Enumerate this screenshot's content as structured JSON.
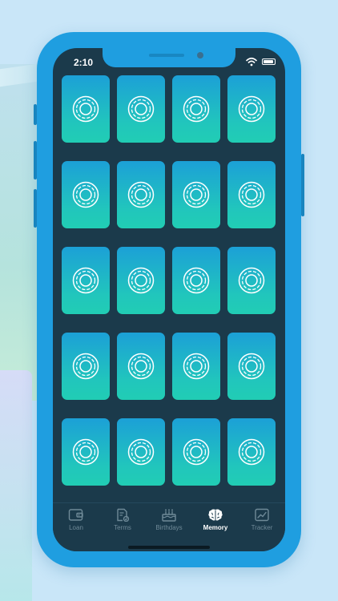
{
  "status": {
    "time": "2:10"
  },
  "icons": {
    "card": "chip-ring-icon",
    "wifi": "wifi-icon",
    "battery": "battery-icon"
  },
  "colors": {
    "phone_frame": "#1f9ee0",
    "screen_bg": "#1b3a4b",
    "card_top": "#1ca0d7",
    "card_bottom": "#21cdb4",
    "tab_inactive": "#6f8a98",
    "tab_active": "#ffffff"
  },
  "grid": {
    "rows": 5,
    "columns": 4,
    "card_count": 20
  },
  "tabs": [
    {
      "label": "Loan",
      "icon": "wallet-icon",
      "active": false
    },
    {
      "label": "Terms",
      "icon": "document-check-icon",
      "active": false
    },
    {
      "label": "Birthdays",
      "icon": "cake-icon",
      "active": false
    },
    {
      "label": "Memory",
      "icon": "brain-icon",
      "active": true
    },
    {
      "label": "Tracker",
      "icon": "chart-check-icon",
      "active": false
    }
  ]
}
